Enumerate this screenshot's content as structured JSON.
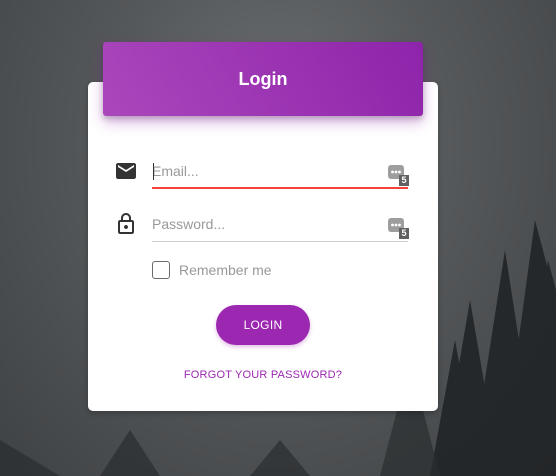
{
  "header": {
    "title": "Login"
  },
  "form": {
    "email": {
      "placeholder": "Email...",
      "value": "",
      "icon": "mail-icon",
      "pw_manager_badge": "5"
    },
    "password": {
      "placeholder": "Password...",
      "value": "",
      "icon": "lock-icon",
      "pw_manager_badge": "5"
    },
    "remember_label": "Remember me",
    "login_label": "LOGIN",
    "forgot_label": "FORGOT YOUR PASSWORD?"
  },
  "colors": {
    "accent": "#9c27b0",
    "error": "#f44336"
  }
}
